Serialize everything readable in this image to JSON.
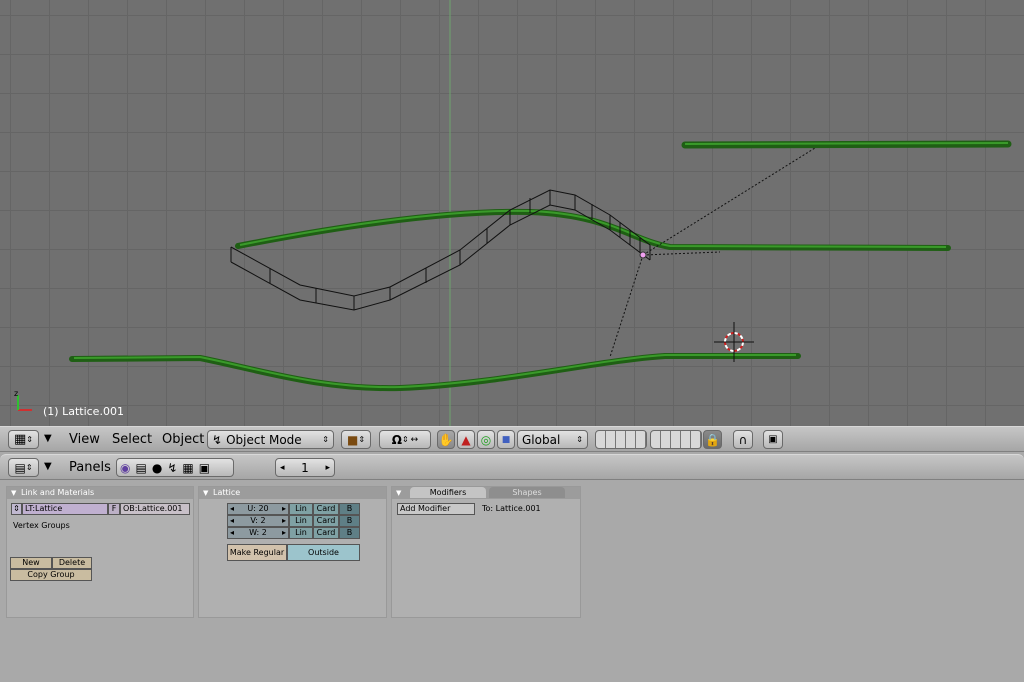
{
  "viewport": {
    "object_label": "(1) Lattice.001",
    "grid_color": "#656565",
    "background_color": "#707070",
    "curve_color": "#2e7d20"
  },
  "header3d": {
    "view_label": "View",
    "select_label": "Select",
    "object_label": "Object",
    "mode_label": "Object Mode",
    "orientation_label": "Global"
  },
  "buttons_header": {
    "panels_label": "Panels",
    "frame_value": "1"
  },
  "link_materials": {
    "title": "Link and Materials",
    "lattice_field": "LT:Lattice",
    "f_button": "F",
    "object_field": "OB:Lattice.001",
    "vertex_groups_label": "Vertex Groups",
    "new_label": "New",
    "delete_label": "Delete",
    "copy_group_label": "Copy Group"
  },
  "lattice": {
    "title": "Lattice",
    "rows": [
      {
        "axis": "U: 20",
        "lin": "Lin",
        "card": "Card",
        "b": "B"
      },
      {
        "axis": "V: 2",
        "lin": "Lin",
        "card": "Card",
        "b": "B"
      },
      {
        "axis": "W: 2",
        "lin": "Lin",
        "card": "Card",
        "b": "B"
      }
    ],
    "make_regular_label": "Make Regular",
    "outside_label": "Outside"
  },
  "modifiers": {
    "tab_modifiers": "Modifiers",
    "tab_shapes": "Shapes",
    "add_modifier_label": "Add Modifier",
    "target_label": "To: Lattice.001"
  }
}
